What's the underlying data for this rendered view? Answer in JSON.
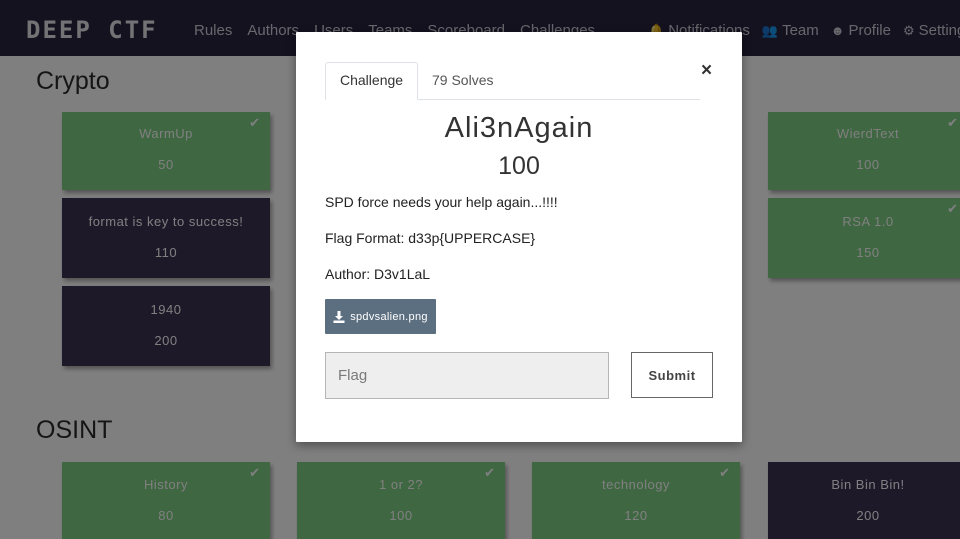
{
  "navbar": {
    "brand": "DEEP CTF",
    "left_links": [
      "Rules",
      "Authors",
      "Users",
      "Teams",
      "Scoreboard",
      "Challenges"
    ],
    "right_links": [
      {
        "label": "Notifications",
        "icon": "bell-icon"
      },
      {
        "label": "Team",
        "icon": "users-icon"
      },
      {
        "label": "Profile",
        "icon": "user-circle-icon"
      },
      {
        "label": "Settings",
        "icon": "cogs-icon"
      }
    ]
  },
  "categories": [
    {
      "title": "Crypto",
      "challenges": [
        {
          "name": "WarmUp",
          "value": "50",
          "solved": true
        },
        {
          "name": "format is key to success!",
          "value": "110",
          "solved": false
        },
        {
          "name": "1940",
          "value": "200",
          "solved": false
        },
        {
          "name": "WierdText",
          "value": "100",
          "solved": true
        },
        {
          "name": "RSA 1.0",
          "value": "150",
          "solved": true
        }
      ]
    },
    {
      "title": "OSINT",
      "challenges": [
        {
          "name": "History",
          "value": "80",
          "solved": true
        },
        {
          "name": "1 or 2?",
          "value": "100",
          "solved": true
        },
        {
          "name": "technology",
          "value": "120",
          "solved": true
        },
        {
          "name": "Bin Bin Bin!",
          "value": "200",
          "solved": false
        }
      ]
    }
  ],
  "modal": {
    "tabs": [
      "Challenge",
      "79 Solves"
    ],
    "close_label": "×",
    "challenge_name": "Ali3nAgain",
    "challenge_value": "100",
    "description": [
      "SPD force needs your help again...!!!!",
      "Flag Format: d33p{UPPERCASE}",
      "Author: D3v1LaL"
    ],
    "file_name": "spdvsalien.png",
    "flag_placeholder": "Flag",
    "submit_label": "Submit"
  },
  "colors": {
    "navbar": "#2a2441",
    "solved": "#7fcf84",
    "unsolved": "#3a3253",
    "download_button": "#5c6f80"
  }
}
